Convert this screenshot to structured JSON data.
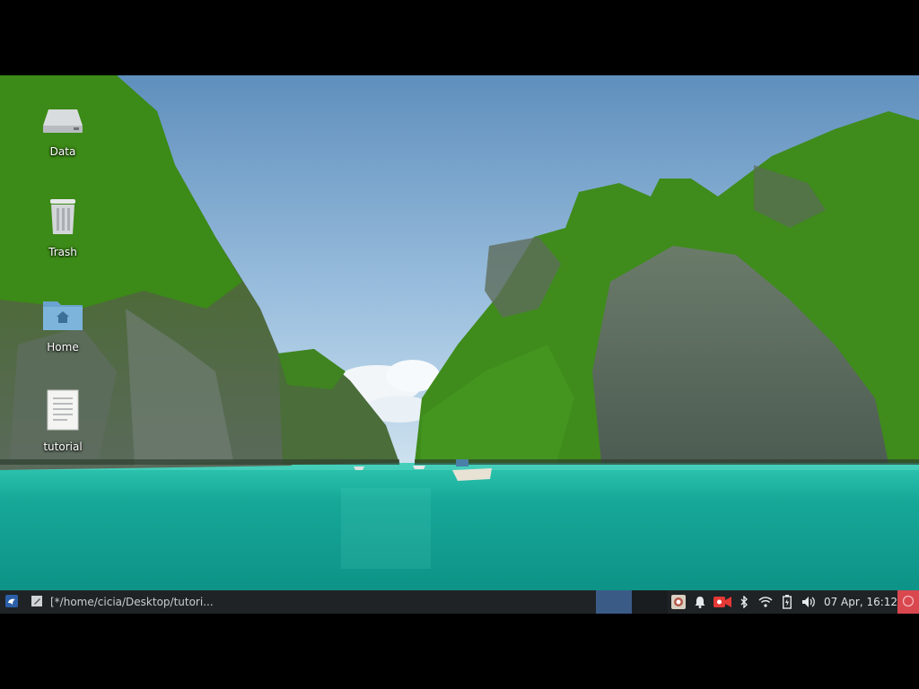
{
  "desktop": {
    "icons": [
      {
        "label": "Data",
        "icon": "drive-icon"
      },
      {
        "label": "Trash",
        "icon": "trash-icon"
      },
      {
        "label": "Home",
        "icon": "home-folder-icon"
      },
      {
        "label": "tutorial",
        "icon": "document-icon"
      }
    ]
  },
  "taskbar": {
    "start_icon": "app-menu-icon",
    "window_title": "[*/home/cicia/Desktop/tutori...",
    "active_workspace_color": "#3b5b87",
    "tray_icons": [
      "screenshot-app-icon",
      "bell-icon",
      "camera-record-icon",
      "bluetooth-icon",
      "wifi-icon",
      "battery-icon",
      "volume-icon"
    ],
    "clock": "07 Apr, 16:12",
    "end_button_icon": "power-icon"
  },
  "colors": {
    "taskbar_bg": "#1f2326",
    "sea": "#12a89a",
    "sky": "#8fb6d8"
  }
}
